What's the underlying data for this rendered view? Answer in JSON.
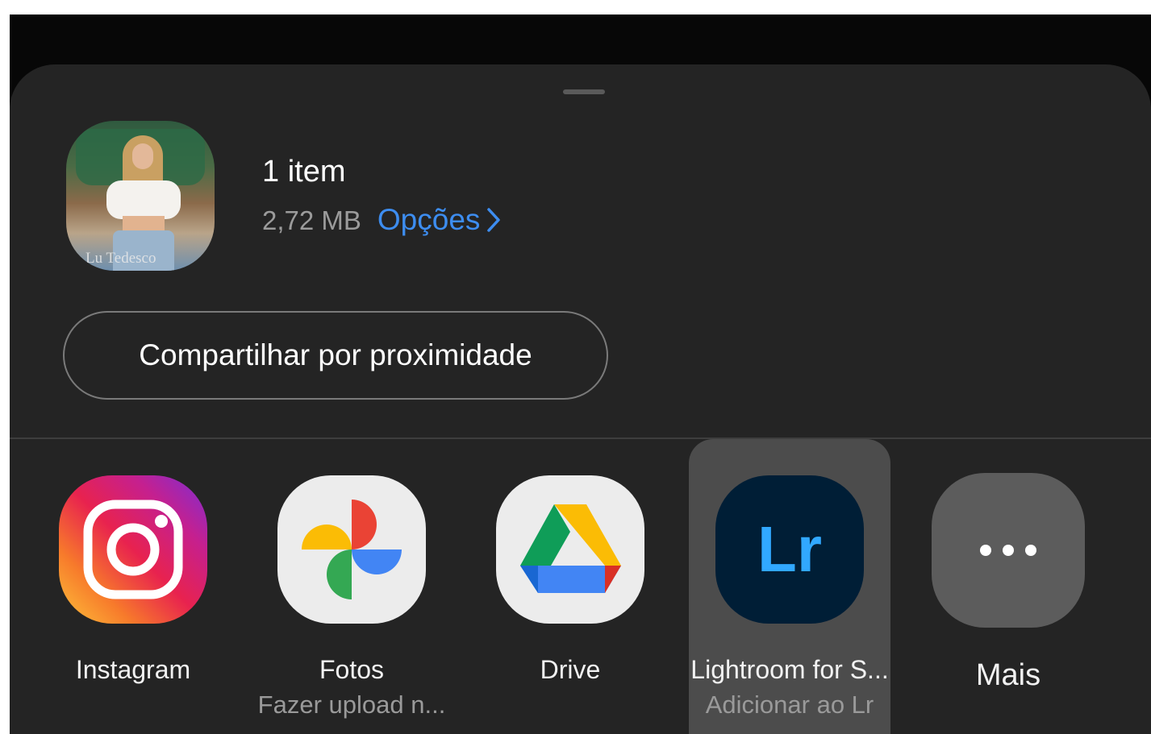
{
  "share_sheet": {
    "item_count": "1 item",
    "file_size": "2,72 MB",
    "options_label": "Opções",
    "thumbnail_watermark": "Lu Tedesco",
    "nearby_share_label": "Compartilhar por proximidade"
  },
  "apps": [
    {
      "label": "Instagram",
      "sublabel": "",
      "icon": "instagram-icon"
    },
    {
      "label": "Fotos",
      "sublabel": "Fazer upload n...",
      "icon": "google-photos-icon"
    },
    {
      "label": "Drive",
      "sublabel": "",
      "icon": "google-drive-icon"
    },
    {
      "label": "Lightroom for S...",
      "sublabel": "Adicionar ao Lr",
      "icon": "lightroom-icon",
      "icon_text": "Lr",
      "selected": true
    },
    {
      "label": "Mais",
      "sublabel": "",
      "icon": "more-dots-icon"
    }
  ],
  "colors": {
    "sheet_background": "#242424",
    "accent": "#3d8df0",
    "selected_tile": "#4c4c4c"
  }
}
